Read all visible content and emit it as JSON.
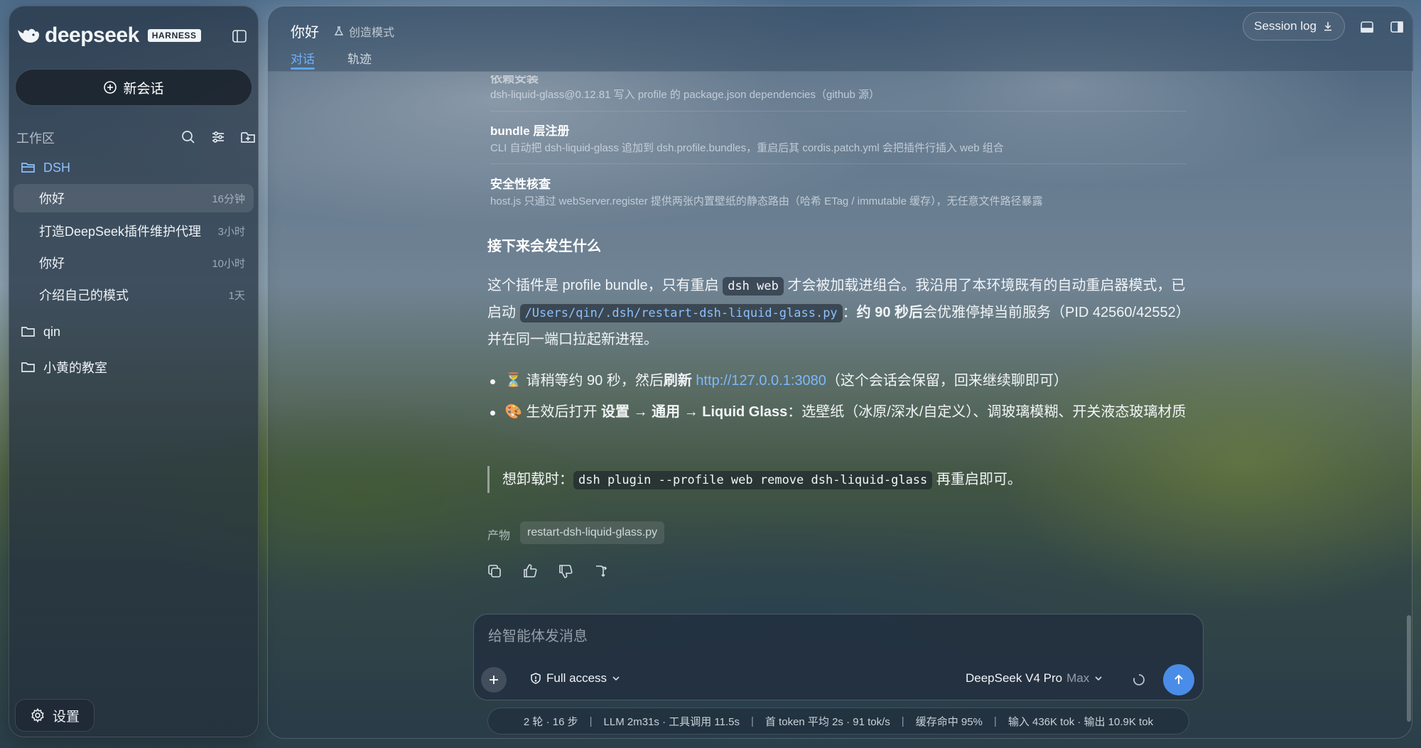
{
  "sidebar": {
    "logo_text": "deepseek",
    "badge": "HARNESS",
    "new_chat": "新会话",
    "workspace_label": "工作区",
    "folders": [
      {
        "name": "DSH"
      },
      {
        "name": "qin"
      },
      {
        "name": "小黄的教室"
      }
    ],
    "chats": [
      {
        "title": "你好",
        "time": "16分钟"
      },
      {
        "title": "打造DeepSeek插件维护代理",
        "time": "3小时"
      },
      {
        "title": "你好",
        "time": "10小时"
      },
      {
        "title": "介绍自己的模式",
        "time": "1天"
      }
    ],
    "settings": "设置"
  },
  "header": {
    "title": "你好",
    "mode": "创造模式",
    "tabs": [
      "对话",
      "轨迹"
    ],
    "active_tab": "对话",
    "session_log": "Session log"
  },
  "message": {
    "details": [
      {
        "title": "依赖安装",
        "desc": "dsh-liquid-glass@0.12.81 写入 profile 的 package.json dependencies（github 源）"
      },
      {
        "title": "bundle 层注册",
        "desc": "CLI 自动把 dsh-liquid-glass 追加到 dsh.profile.bundles，重启后其 cordis.patch.yml 会把插件行插入 web 组合"
      },
      {
        "title": "安全性核查",
        "desc": "host.js 只通过 webServer.register 提供两张内置壁纸的静态路由（哈希 ETag / immutable 缓存），无任意文件路径暴露"
      }
    ],
    "heading": "接下来会发生什么",
    "para": {
      "p1": "这个插件是 profile bundle，只有重启 ",
      "code1": "dsh web",
      "p2": " 才会被加载进组合。我沿用了本环境既有的自动重启器模式，已启动 ",
      "code2": "/Users/qin/.dsh/restart-dsh-liquid-glass.py",
      "p3": "：",
      "b1": "约 90 秒后",
      "p4": "会优雅停掉当前服务（PID 42560/42552）并在同一端口拉起新进程。"
    },
    "bullets": [
      {
        "icon": "⏳",
        "pre": " 请稍等约 90 秒，然后",
        "bold": "刷新",
        "url": "http://127.0.0.1:3080",
        "post": "（这个会话会保留，回来继续聊即可）"
      },
      {
        "icon": "🎨",
        "pre": " 生效后打开 ",
        "bold": "设置 → 通用 → Liquid Glass",
        "post": "：选壁纸（冰原/深水/自定义）、调玻璃模糊、开关液态玻璃材质"
      }
    ],
    "quote": {
      "pre": "想卸载时：",
      "code": "dsh plugin --profile web remove dsh-liquid-glass",
      "post": " 再重启即可。"
    },
    "artifact_label": "产物",
    "artifact_file": "restart-dsh-liquid-glass.py"
  },
  "composer": {
    "placeholder": "给智能体发消息",
    "access": "Full access",
    "model": "DeepSeek V4 Pro",
    "model_suffix": "Max"
  },
  "stats": {
    "rounds": "2 轮 · 16 步",
    "llm": "LLM 2m31s · 工具调用 11.5s",
    "first_token": "首 token 平均 2s · 91 tok/s",
    "cache": "缓存命中 95%",
    "tokens": "输入 436K tok · 输出 10.9K tok"
  },
  "colors": {
    "accent": "#5aa4ff",
    "link": "#7db8ff",
    "send": "#4a8de8"
  }
}
